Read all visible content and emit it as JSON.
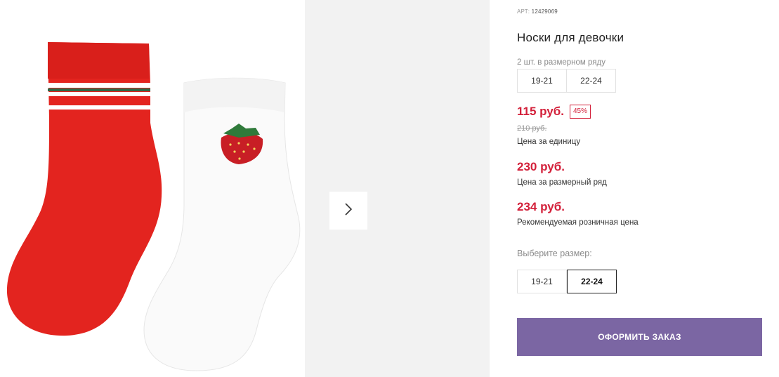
{
  "product": {
    "article_label": "АРТ:",
    "article_value": "12429069",
    "title": "Носки для девочки"
  },
  "pack": {
    "label": "2 шт. в размерном ряду",
    "sizes": [
      "19-21",
      "22-24"
    ]
  },
  "prices": {
    "unit_price": "115 руб.",
    "discount": "45%",
    "old_price": "210 руб.",
    "unit_caption": "Цена за единицу",
    "row_price": "230 руб.",
    "row_caption": "Цена за размерный ряд",
    "retail_price": "234 руб.",
    "retail_caption": "Рекомендуемая розничная цена"
  },
  "size_picker": {
    "label": "Выберите размер:",
    "options": [
      "19-21",
      "22-24"
    ],
    "selected": "22-24"
  },
  "order_button": "ОФОРМИТЬ ЗАКАЗ",
  "colors": {
    "accent_red": "#d3203a",
    "button_purple": "#7b66a3"
  },
  "icons": {
    "next": "chevron-right-icon"
  }
}
